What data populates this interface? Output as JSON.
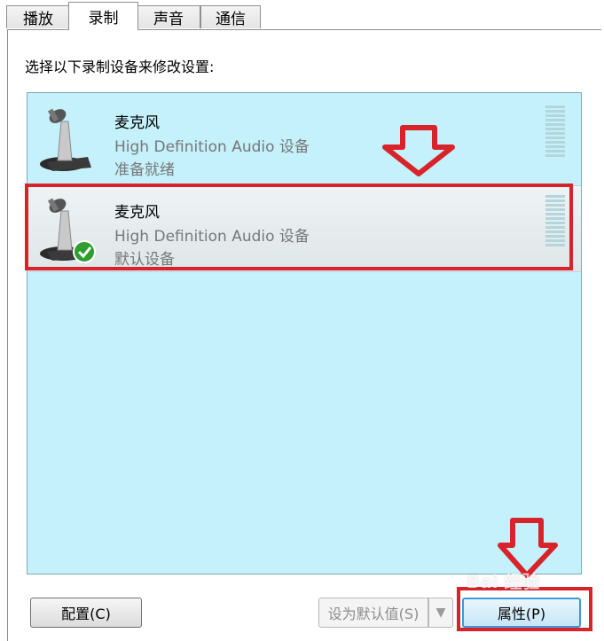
{
  "tabs": [
    {
      "label": "播放"
    },
    {
      "label": "录制"
    },
    {
      "label": "声音"
    },
    {
      "label": "通信"
    }
  ],
  "instruction": "选择以下录制设备来修改设置:",
  "devices": [
    {
      "name": "麦克风",
      "description": "High Definition Audio 设备",
      "status": "准备就绪",
      "icon": "microphone-icon"
    },
    {
      "name": "麦克风",
      "description": "High Definition Audio 设备",
      "status": "默认设备",
      "icon": "microphone-icon",
      "badge": "check-icon"
    }
  ],
  "buttons": {
    "configure": "配置(C)",
    "set_default": "设为默认值(S)",
    "set_default_arrow": "▼",
    "properties": "属性(P)"
  },
  "watermark": "Bai 经验",
  "colors": {
    "highlight": "#d8232a",
    "list_bg": "#c4f1fb"
  }
}
